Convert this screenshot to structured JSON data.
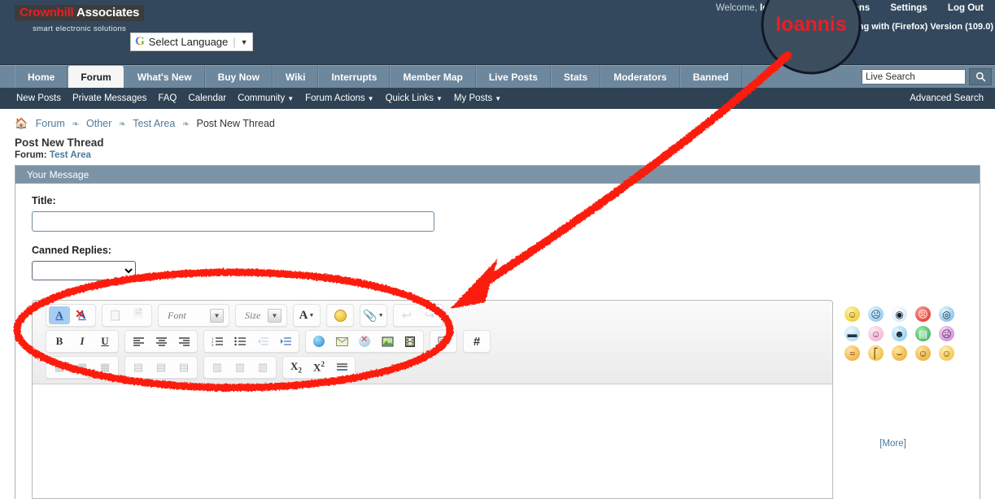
{
  "header": {
    "logo_primary": "Crownhill",
    "logo_secondary": "Associates",
    "tagline": "smart electronic solutions",
    "translate": {
      "icon": "google-g-icon",
      "label": "Select Language",
      "caret": "▼"
    },
    "welcome_prefix": "Welcome,",
    "username": "Ioannis",
    "notifications_label": "Notifications",
    "settings_label": "Settings",
    "logout_label": "Log Out",
    "browser_notice": "ng with (Firefox) Version (109.0)",
    "colors": {
      "bar": "#33485c",
      "accent_red": "#ee1c25"
    }
  },
  "nav": {
    "tabs": [
      {
        "label": "Home",
        "active": false
      },
      {
        "label": "Forum",
        "active": true
      },
      {
        "label": "What's New",
        "active": false
      },
      {
        "label": "Buy Now",
        "active": false
      },
      {
        "label": "Wiki",
        "active": false
      },
      {
        "label": "Interrupts",
        "active": false
      },
      {
        "label": "Member Map",
        "active": false
      },
      {
        "label": "Live Posts",
        "active": false
      },
      {
        "label": "Stats",
        "active": false
      },
      {
        "label": "Moderators",
        "active": false
      },
      {
        "label": "Banned",
        "active": false
      }
    ],
    "search": {
      "value": "Live Search",
      "icon": "search-icon"
    },
    "sub_items": [
      {
        "label": "New Posts",
        "caret": false
      },
      {
        "label": "Private Messages",
        "caret": false
      },
      {
        "label": "FAQ",
        "caret": false
      },
      {
        "label": "Calendar",
        "caret": false
      },
      {
        "label": "Community",
        "caret": true
      },
      {
        "label": "Forum Actions",
        "caret": true
      },
      {
        "label": "Quick Links",
        "caret": true
      },
      {
        "label": "My Posts",
        "caret": true
      }
    ],
    "advanced_search": "Advanced Search"
  },
  "breadcrumb": {
    "home_icon": "home-icon",
    "items": [
      "Forum",
      "Other",
      "Test Area"
    ],
    "current": "Post New Thread",
    "separator": "❧"
  },
  "page": {
    "title": "Post New Thread",
    "forum_prefix": "Forum:",
    "forum_name": "Test Area"
  },
  "form": {
    "panel_title": "Your Message",
    "title_label": "Title:",
    "title_value": "",
    "canned_label": "Canned Replies:",
    "canned_value": "",
    "canned_options": [
      ""
    ]
  },
  "toolbar": {
    "row1": [
      {
        "group": [
          {
            "name": "wysiwyg-toggle-icon",
            "glyph": "ᴬA",
            "state": "on"
          },
          {
            "name": "remove-format-icon",
            "glyph": "A",
            "state": "normal"
          }
        ]
      },
      {
        "group": [
          {
            "name": "paste-icon",
            "glyph": "Ὄb",
            "state": "dim"
          },
          {
            "name": "paste-from-word-icon",
            "glyph": "W",
            "state": "dim"
          }
        ]
      },
      {
        "group": [
          {
            "name": "font-family-select",
            "label": "Font",
            "type": "select"
          }
        ]
      },
      {
        "group": [
          {
            "name": "font-size-select",
            "label": "Size",
            "type": "select-small"
          }
        ]
      },
      {
        "group": [
          {
            "name": "text-color-icon",
            "glyph": "A",
            "state": "normal"
          }
        ]
      },
      {
        "group": [
          {
            "name": "smilies-icon",
            "glyph": "☺",
            "state": "normal"
          }
        ]
      },
      {
        "group": [
          {
            "name": "attachment-icon",
            "glyph": "Ὄe",
            "state": "normal"
          }
        ]
      },
      {
        "group": [
          {
            "name": "undo-icon",
            "glyph": "↩",
            "state": "dim"
          },
          {
            "name": "redo-icon",
            "glyph": "↪",
            "state": "dim"
          }
        ]
      }
    ],
    "row2": [
      {
        "group": [
          {
            "name": "bold-icon",
            "glyph": "B"
          },
          {
            "name": "italic-icon",
            "glyph": "I"
          },
          {
            "name": "underline-icon",
            "glyph": "U"
          }
        ]
      },
      {
        "group": [
          {
            "name": "align-left-icon",
            "glyph": "≡"
          },
          {
            "name": "align-center-icon",
            "glyph": "≡"
          },
          {
            "name": "align-right-icon",
            "glyph": "≡"
          }
        ]
      },
      {
        "group": [
          {
            "name": "ordered-list-icon",
            "glyph": "≣"
          },
          {
            "name": "unordered-list-icon",
            "glyph": "≣"
          },
          {
            "name": "outdent-icon",
            "glyph": "←"
          },
          {
            "name": "indent-icon",
            "glyph": "→"
          }
        ]
      },
      {
        "group": [
          {
            "name": "insert-link-icon",
            "glyph": "ἱ0"
          },
          {
            "name": "insert-email-icon",
            "glyph": "✉"
          },
          {
            "name": "remove-link-icon",
            "glyph": "ἱ0"
          },
          {
            "name": "insert-image-icon",
            "glyph": "Ὓc"
          },
          {
            "name": "insert-video-icon",
            "glyph": "Ἱe"
          }
        ]
      },
      {
        "group": [
          {
            "name": "quote-icon",
            "glyph": "὞8"
          }
        ]
      },
      {
        "group": [
          {
            "name": "code-icon",
            "glyph": "#"
          }
        ]
      }
    ],
    "row3": [
      {
        "group": [
          {
            "name": "insert-table-icon",
            "glyph": "▦"
          },
          {
            "name": "table-properties-icon",
            "glyph": "▦"
          },
          {
            "name": "delete-table-icon",
            "glyph": "▦"
          }
        ]
      },
      {
        "group": [
          {
            "name": "insert-column-before-icon",
            "glyph": "▤"
          },
          {
            "name": "insert-column-after-icon",
            "glyph": "▤"
          },
          {
            "name": "delete-column-icon",
            "glyph": "▤"
          }
        ]
      },
      {
        "group": [
          {
            "name": "insert-row-before-icon",
            "glyph": "▥"
          },
          {
            "name": "insert-row-after-icon",
            "glyph": "▥"
          },
          {
            "name": "delete-row-icon",
            "glyph": "▥"
          }
        ]
      },
      {
        "group": [
          {
            "name": "subscript-icon",
            "glyph": "X₂"
          },
          {
            "name": "superscript-icon",
            "glyph": "X²"
          },
          {
            "name": "horizontal-rule-icon",
            "glyph": "≡"
          }
        ]
      }
    ],
    "message_value": ""
  },
  "smilies": {
    "items": [
      {
        "name": "smilie-smile",
        "glyph": "☺",
        "color": "#f5d442"
      },
      {
        "name": "smilie-confused",
        "glyph": "☹",
        "color": "#a8d8f0"
      },
      {
        "name": "smilie-eek",
        "glyph": "◎",
        "color": "#ffffff"
      },
      {
        "name": "smilie-mad",
        "glyph": "☹",
        "color": "#e03c31"
      },
      {
        "name": "smilie-rolleyes",
        "glyph": "◉",
        "color": "#7fc4e8"
      },
      {
        "name": "smilie-cool",
        "glyph": "▬",
        "color": "#b9e0f5"
      },
      {
        "name": "smilie-redface",
        "glyph": "☺",
        "color": "#f7c8dd"
      },
      {
        "name": "smilie-wink",
        "glyph": "☻",
        "color": "#9fd8f2"
      },
      {
        "name": "smilie-biggrin",
        "glyph": "▤",
        "color": "#4cbf6a"
      },
      {
        "name": "smilie-frown",
        "glyph": "☹",
        "color": "#d98fd0"
      },
      {
        "name": "smilie-wink2",
        "glyph": "≈",
        "color": "#f7b733"
      },
      {
        "name": "smilie-grin",
        "glyph": "◡",
        "color": "#f5c13c"
      },
      {
        "name": "smilie-sad",
        "glyph": "⌢",
        "color": "#f0b429"
      },
      {
        "name": "smilie-tongue",
        "glyph": "⤵",
        "color": "#f2b01e"
      },
      {
        "name": "smilie-happy",
        "glyph": "◡",
        "color": "#f6c445"
      }
    ],
    "more_label": "[More]"
  },
  "annotation": {
    "color": "#fc1c11",
    "magnifier_text": "Ioannis",
    "shapes": [
      "magnifier-circle",
      "arrow",
      "ellipse"
    ]
  }
}
